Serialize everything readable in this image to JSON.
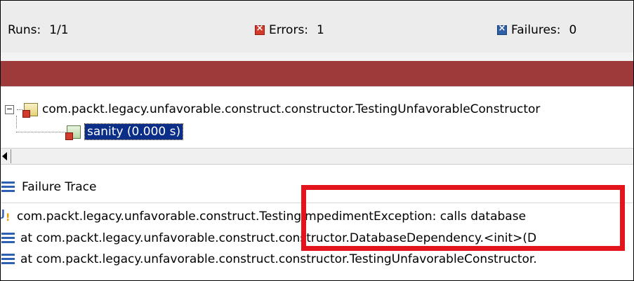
{
  "summary": {
    "runs_label": "Runs:",
    "runs_value": "1/1",
    "errors_label": "Errors:",
    "errors_value": "1",
    "failures_label": "Failures:",
    "failures_value": "0",
    "error_icon": "error-icon",
    "failure_icon": "failure-icon"
  },
  "progress": {
    "status_color": "#9e3a3a",
    "fraction": 1.0
  },
  "tree": {
    "suite": {
      "label": "com.packt.legacy.unfavorable.construct.constructor.TestingUnfavorableConstructor",
      "expander": "−",
      "icon": "test-suite-error-icon"
    },
    "test": {
      "label": "sanity (0.000 s)",
      "icon": "test-error-icon",
      "selected": true
    }
  },
  "trace": {
    "header": "Failure Trace",
    "lines": [
      {
        "icon": "java-exception-icon",
        "text": "com.packt.legacy.unfavorable.construct.TestingImpedimentException: calls database"
      },
      {
        "icon": "stack-frame-icon",
        "text": "at com.packt.legacy.unfavorable.construct.constructor.DatabaseDependency.<init>(D"
      },
      {
        "icon": "stack-frame-icon",
        "text": "at com.packt.legacy.unfavorable.construct.constructor.TestingUnfavorableConstructor."
      }
    ]
  },
  "highlight_color": "#e3141c"
}
